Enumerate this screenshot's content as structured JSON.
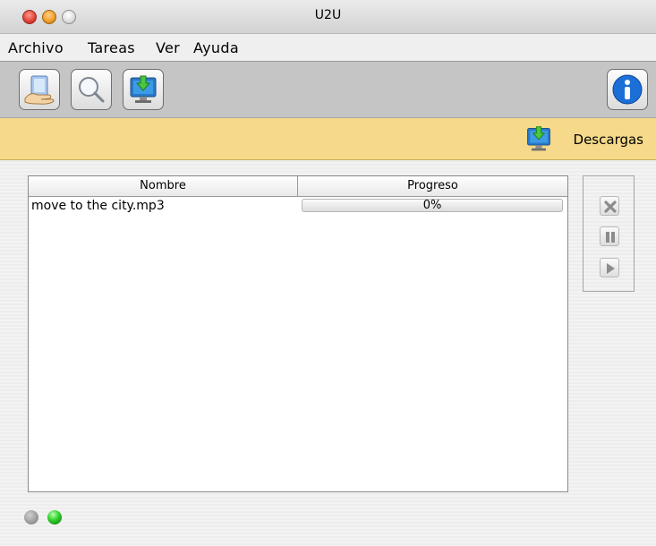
{
  "window": {
    "title": "U2U"
  },
  "menu": {
    "items": [
      "Archivo",
      "Tareas",
      "Ver",
      "Ayuda"
    ]
  },
  "toolbar": {
    "buttons": [
      {
        "icon": "shared-files-hand-icon"
      },
      {
        "icon": "search-magnifier-icon"
      },
      {
        "icon": "downloads-monitor-icon"
      }
    ],
    "info_icon": "info-icon"
  },
  "banner": {
    "label": "Descargas",
    "icon": "downloads-monitor-icon"
  },
  "downloads": {
    "columns": [
      "Nombre",
      "Progreso"
    ],
    "rows": [
      {
        "name": "move to the city.mp3",
        "progress_text": "0%",
        "progress": 0
      }
    ]
  },
  "controls": {
    "icons": [
      "cancel-icon",
      "pause-icon",
      "play-icon"
    ]
  },
  "status": {
    "indicators": [
      "gray",
      "green"
    ]
  }
}
